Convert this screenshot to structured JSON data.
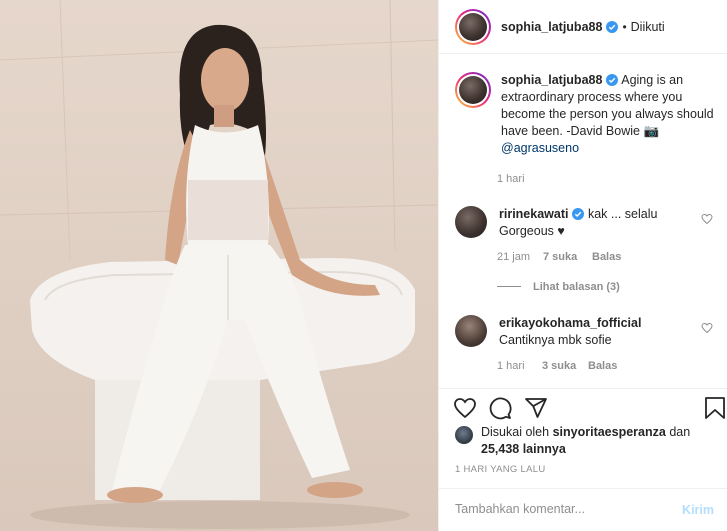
{
  "post": {
    "author": "sophia_latjuba88",
    "follow_state": "Diikuti",
    "dot": "•"
  },
  "caption": {
    "username": "sophia_latjuba88",
    "text": "Aging is an extraordinary process where you become the person you always should have been. -David Bowie 📷",
    "mention": "@agrasuseno",
    "time": "1 hari"
  },
  "comments": [
    {
      "username": "ririnekawati",
      "text": "kak ... selalu Gorgeous ♥",
      "time": "21 jam",
      "likes": "7 suka",
      "reply": "Balas",
      "view_replies": "Lihat balasan (3)"
    },
    {
      "username": "erikayokohama_fofficial",
      "text": "Cantiknya mbk sofie",
      "time": "1 hari",
      "likes": "3 suka",
      "reply": "Balas"
    }
  ],
  "likes_summary": {
    "prefix": "Disukai oleh",
    "liker": "sinyoritaesperanza",
    "middle": "dan",
    "count": "25,438 lainnya"
  },
  "time_ago": "1 HARI YANG LALU",
  "add_comment": {
    "placeholder": "Tambahkan komentar...",
    "post_label": "Kirim"
  },
  "colors": {
    "verified": "#3897f0",
    "text": "#262626",
    "muted": "#8e8e8e",
    "post_disabled": "#b2dffc"
  },
  "icons": [
    "verified-badge-icon",
    "heart-icon",
    "comment-icon",
    "share-icon",
    "bookmark-icon",
    "small-heart-icon"
  ]
}
